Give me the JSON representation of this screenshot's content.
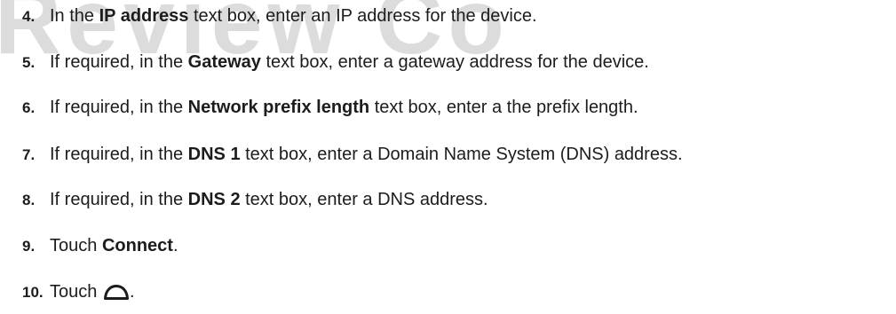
{
  "watermark": {
    "text": "Review Co"
  },
  "steps": [
    {
      "number": "4.",
      "before": "In the ",
      "bold": "IP address",
      "after": " text box, enter an IP address for the device."
    },
    {
      "number": "5.",
      "before": "If required, in the ",
      "bold": "Gateway",
      "after": " text box, enter a gateway address for the device."
    },
    {
      "number": "6.",
      "before": "If required, in the ",
      "bold": "Network prefix length",
      "after": " text box, enter a the prefix length."
    },
    {
      "number": "7.",
      "before": "If required, in the ",
      "bold": "DNS 1",
      "after": " text box, enter a Domain Name System (DNS) address."
    },
    {
      "number": "8.",
      "before": "If required, in the ",
      "bold": "DNS 2",
      "after": " text box, enter a DNS address."
    },
    {
      "number": "9.",
      "before": "Touch ",
      "bold": "Connect",
      "after": "."
    },
    {
      "number": "10.",
      "before": "Touch ",
      "icon": "home-icon",
      "after": "."
    }
  ]
}
